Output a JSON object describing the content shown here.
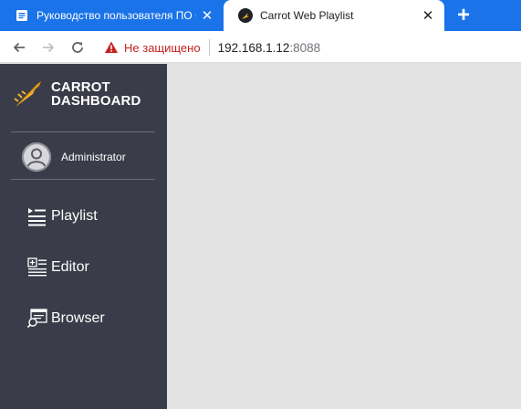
{
  "browser": {
    "tabs": [
      {
        "title": "Руководство пользователя ПО Carrot",
        "icon": "document-icon",
        "active": false
      },
      {
        "title": "Carrot Web Playlist",
        "icon": "carrot-logo-icon",
        "active": true
      }
    ],
    "close_glyph": "✕",
    "new_tab_glyph": "+",
    "security_label": "Не защищено",
    "url_host": "192.168.1.12",
    "url_port": ":8088",
    "colors": {
      "tabstrip": "#1a73e8",
      "insecure": "#c5221f"
    }
  },
  "sidebar": {
    "brand_line1": "CARROT",
    "brand_line2": "DASHBOARD",
    "user_name": "Administrator",
    "items": [
      {
        "label": "Playlist",
        "icon": "playlist-icon"
      },
      {
        "label": "Editor",
        "icon": "editor-icon"
      },
      {
        "label": "Browser",
        "icon": "browser-icon"
      }
    ],
    "colors": {
      "background": "#3b3c49",
      "accent": "#f0b429"
    }
  }
}
